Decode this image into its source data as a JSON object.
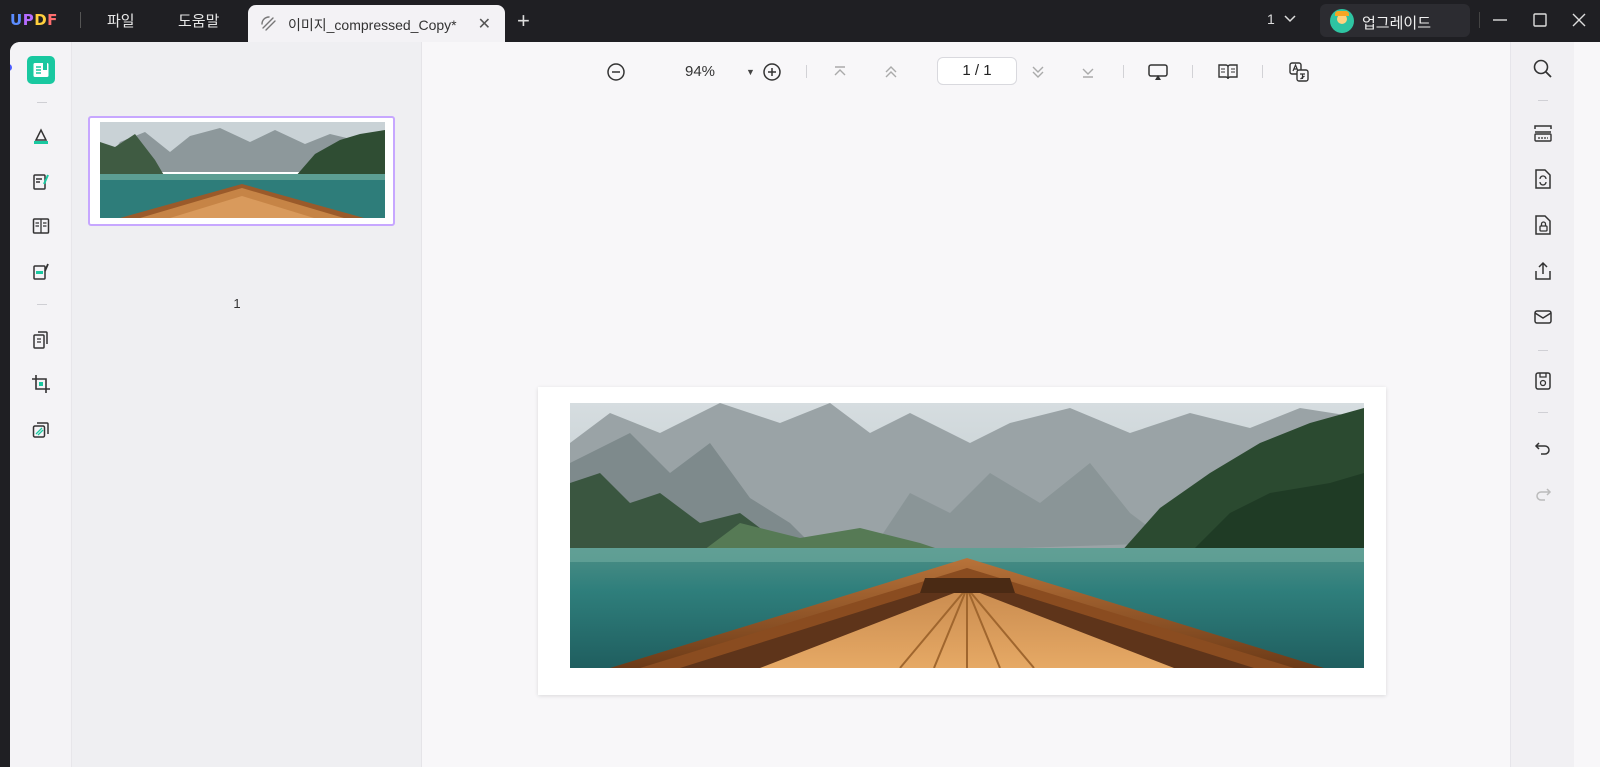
{
  "app": {
    "logo": {
      "u": "U",
      "p": "P",
      "d": "D",
      "f": "F"
    },
    "menu": [
      "파일",
      "도움말"
    ],
    "tab": {
      "title": "이미지_compressed_Copy*",
      "close": "✕"
    },
    "new_tab": "+",
    "page_indicator": "1",
    "upgrade_label": "업그레이드"
  },
  "toolbar": {
    "zoom": "94%",
    "zoom_caret": "▼",
    "page_field": "1 / 1"
  },
  "thumbnails": [
    {
      "page_number": "1",
      "selected": true
    }
  ],
  "colors": {
    "accent": "#19c8a0",
    "selection": "#c7a7ff",
    "titlebar": "#1f1f23"
  },
  "icons": {
    "left_rail": [
      "reader-icon",
      "comment-icon",
      "edit-pdf-icon",
      "page-layout-icon",
      "fill-sign-icon",
      "organize-pages-icon",
      "crop-icon",
      "page-tools-icon"
    ],
    "right_rail": [
      "search-icon",
      "ocr-icon",
      "convert-icon",
      "protect-icon",
      "share-icon",
      "email-icon",
      "save-icon",
      "undo-icon",
      "redo-icon"
    ]
  }
}
